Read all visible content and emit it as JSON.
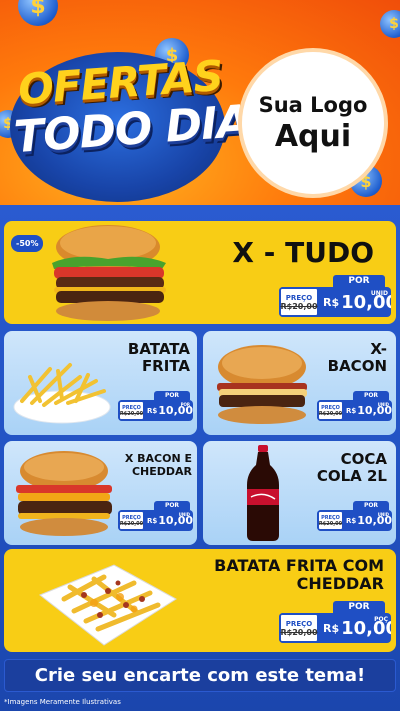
{
  "header": {
    "title_line1": "OFERTAS",
    "title_line2": "TODO DIA",
    "coin_symbol": "$",
    "logo": {
      "line1": "Sua Logo",
      "line2": "Aqui"
    }
  },
  "products": [
    {
      "name": "X - TUDO",
      "badge": "-50%",
      "price_label": "PREÇO",
      "old_price": "R$20,00",
      "por": "POR",
      "currency": "R$",
      "value": "10,00",
      "unit": "UNID"
    },
    {
      "name": "BATATA FRITA",
      "price_label": "PREÇO",
      "old_price": "R$20,00",
      "por": "POR",
      "currency": "R$",
      "value": "10,00",
      "unit": "POR"
    },
    {
      "name": "X-BACON",
      "price_label": "PREÇO",
      "old_price": "R$20,00",
      "por": "POR",
      "currency": "R$",
      "value": "10,00",
      "unit": "UNID"
    },
    {
      "name": "X BACON E CHEDDAR",
      "price_label": "PREÇO",
      "old_price": "R$20,00",
      "por": "POR",
      "currency": "R$",
      "value": "10,00",
      "unit": "UNID"
    },
    {
      "name": "COCA COLA 2L",
      "price_label": "PREÇO",
      "old_price": "R$20,00",
      "por": "POR",
      "currency": "R$",
      "value": "10,00",
      "unit": "UNID"
    },
    {
      "name": "BATATA FRITA COM CHEDDAR",
      "price_label": "PREÇO",
      "old_price": "R$20,00",
      "por": "POR",
      "currency": "R$",
      "value": "10,00",
      "unit": "POÇ"
    }
  ],
  "footer": {
    "cta": "Crie seu encarte com este tema!",
    "disclaimer": "*Imagens Meramente Ilustrativas"
  },
  "colors": {
    "header_orange": "#f04e0a",
    "brand_blue": "#1f4fc4",
    "card_yellow": "#f8cd15",
    "card_blue": "#cfe6fb"
  }
}
